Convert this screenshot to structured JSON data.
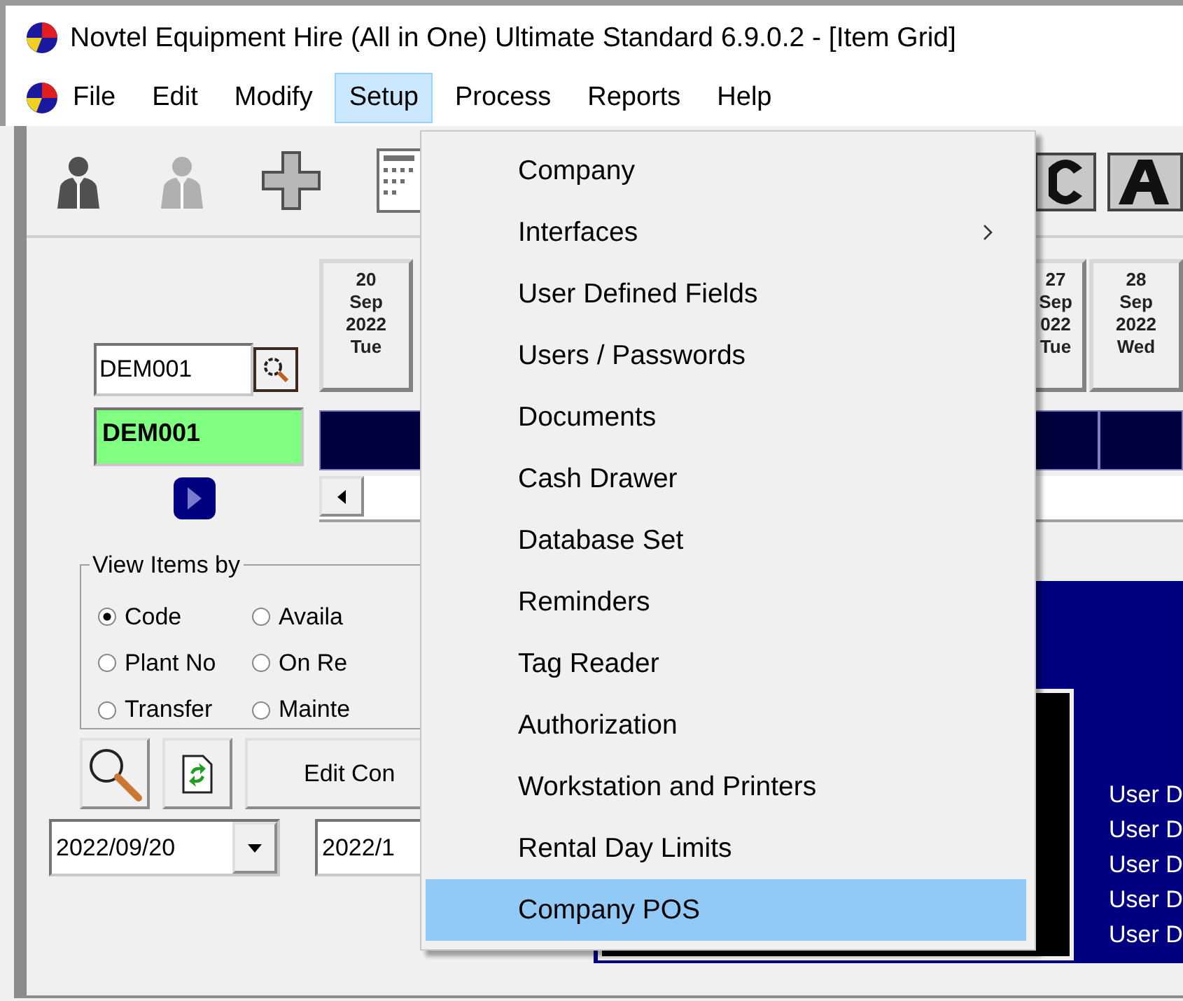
{
  "window": {
    "title": "Novtel Equipment Hire (All in One) Ultimate Standard 6.9.0.2 - [Item Grid]"
  },
  "menu_bar": [
    {
      "label": "File",
      "selected": false
    },
    {
      "label": "Edit",
      "selected": false
    },
    {
      "label": "Modify",
      "selected": false
    },
    {
      "label": "Setup",
      "selected": true
    },
    {
      "label": "Process",
      "selected": false
    },
    {
      "label": "Reports",
      "selected": false
    },
    {
      "label": "Help",
      "selected": false
    }
  ],
  "item_search": {
    "value": "DEM001"
  },
  "item_code": "DEM001",
  "date_columns": [
    {
      "day": "20",
      "month": "Sep",
      "year": "2022",
      "weekday": "Tue"
    }
  ],
  "date_columns_right": [
    {
      "day": "27",
      "month": "Sep",
      "year": "022",
      "weekday": "Tue"
    },
    {
      "day": "28",
      "month": "Sep",
      "year": "2022",
      "weekday": "Wed"
    }
  ],
  "view_items_by": {
    "label": "View Items by",
    "options": [
      {
        "label": "Code",
        "selected": true
      },
      {
        "label": "Availa",
        "selected": false
      },
      {
        "label": "Plant No",
        "selected": false
      },
      {
        "label": "On Re",
        "selected": false
      },
      {
        "label": "Transfer",
        "selected": false
      },
      {
        "label": "Mainte",
        "selected": false
      }
    ]
  },
  "edit_button": "Edit Con",
  "date_from": "2022/09/20",
  "date_to": "2022/1",
  "panel_lines": [
    "User D",
    "User D",
    "User D",
    "User D",
    "User D"
  ],
  "setup_menu": {
    "items": [
      {
        "label": "Company",
        "submenu": false,
        "selected": false
      },
      {
        "label": "Interfaces",
        "submenu": true,
        "selected": false
      },
      {
        "label": "User Defined Fields",
        "submenu": false,
        "selected": false
      },
      {
        "label": "Users / Passwords",
        "submenu": false,
        "selected": false
      },
      {
        "label": "Documents",
        "submenu": false,
        "selected": false
      },
      {
        "label": "Cash Drawer",
        "submenu": false,
        "selected": false
      },
      {
        "label": "Database Set",
        "submenu": false,
        "selected": false
      },
      {
        "label": "Reminders",
        "submenu": false,
        "selected": false
      },
      {
        "label": "Tag Reader",
        "submenu": false,
        "selected": false
      },
      {
        "label": "Authorization",
        "submenu": false,
        "selected": false
      },
      {
        "label": "Workstation and Printers",
        "submenu": false,
        "selected": false
      },
      {
        "label": "Rental Day Limits",
        "submenu": false,
        "selected": false
      },
      {
        "label": "Company POS",
        "submenu": false,
        "selected": true
      }
    ]
  }
}
